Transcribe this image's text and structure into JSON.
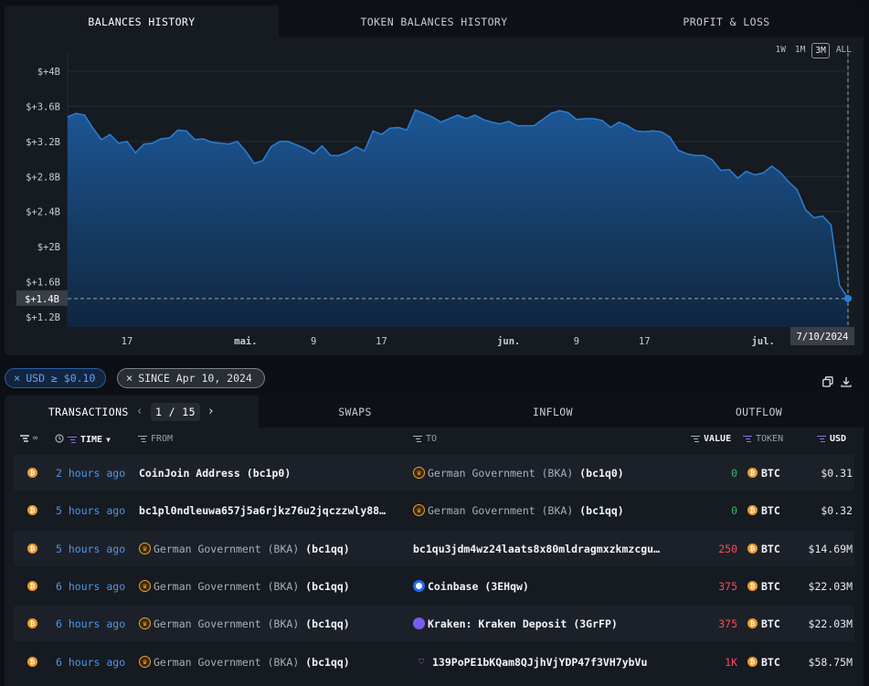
{
  "top_tabs": [
    "BALANCES HISTORY",
    "TOKEN BALANCES HISTORY",
    "PROFIT & LOSS"
  ],
  "time_ranges": [
    "1W",
    "1M",
    "3M",
    "ALL"
  ],
  "selected_range": "3M",
  "chart_data": {
    "type": "area",
    "y_ticks": [
      "$+4B",
      "$+3.6B",
      "$+3.2B",
      "$+2.8B",
      "$+2.4B",
      "$+2B",
      "$+1.6B",
      "$+1.2B"
    ],
    "x_ticks": [
      "17",
      "mai.",
      "9",
      "17",
      "jun.",
      "9",
      "17",
      "jul."
    ],
    "crosshair_y_label": "$+1.4B",
    "crosshair_x_label": "7/10/2024",
    "ylim": [
      1.2,
      4.0
    ],
    "y_unit": "billion USD",
    "x": [
      "2024-04-10",
      "2024-04-11",
      "2024-04-12",
      "2024-04-13",
      "2024-04-14",
      "2024-04-15",
      "2024-04-16",
      "2024-04-17",
      "2024-04-18",
      "2024-04-19",
      "2024-04-20",
      "2024-04-21",
      "2024-04-22",
      "2024-04-23",
      "2024-04-24",
      "2024-04-25",
      "2024-04-26",
      "2024-04-27",
      "2024-04-28",
      "2024-04-29",
      "2024-04-30",
      "2024-05-01",
      "2024-05-02",
      "2024-05-03",
      "2024-05-04",
      "2024-05-05",
      "2024-05-06",
      "2024-05-07",
      "2024-05-08",
      "2024-05-09",
      "2024-05-10",
      "2024-05-11",
      "2024-05-12",
      "2024-05-13",
      "2024-05-14",
      "2024-05-15",
      "2024-05-16",
      "2024-05-17",
      "2024-05-18",
      "2024-05-19",
      "2024-05-20",
      "2024-05-21",
      "2024-05-22",
      "2024-05-23",
      "2024-05-24",
      "2024-05-25",
      "2024-05-26",
      "2024-05-27",
      "2024-05-28",
      "2024-05-29",
      "2024-05-30",
      "2024-05-31",
      "2024-06-01",
      "2024-06-02",
      "2024-06-03",
      "2024-06-04",
      "2024-06-05",
      "2024-06-06",
      "2024-06-07",
      "2024-06-08",
      "2024-06-09",
      "2024-06-10",
      "2024-06-11",
      "2024-06-12",
      "2024-06-13",
      "2024-06-14",
      "2024-06-15",
      "2024-06-16",
      "2024-06-17",
      "2024-06-18",
      "2024-06-19",
      "2024-06-20",
      "2024-06-21",
      "2024-06-22",
      "2024-06-23",
      "2024-06-24",
      "2024-06-25",
      "2024-06-26",
      "2024-06-27",
      "2024-06-28",
      "2024-06-29",
      "2024-06-30",
      "2024-07-01",
      "2024-07-02",
      "2024-07-03",
      "2024-07-04",
      "2024-07-05",
      "2024-07-06",
      "2024-07-07",
      "2024-07-08",
      "2024-07-09",
      "2024-07-10"
    ],
    "values": [
      3.48,
      3.52,
      3.5,
      3.35,
      3.22,
      3.28,
      3.18,
      3.2,
      3.07,
      3.17,
      3.18,
      3.23,
      3.24,
      3.33,
      3.32,
      3.22,
      3.23,
      3.19,
      3.18,
      3.17,
      3.2,
      3.09,
      2.95,
      2.98,
      3.14,
      3.2,
      3.2,
      3.16,
      3.12,
      3.06,
      3.15,
      3.04,
      3.04,
      3.08,
      3.14,
      3.09,
      3.32,
      3.28,
      3.35,
      3.36,
      3.33,
      3.56,
      3.52,
      3.48,
      3.42,
      3.46,
      3.5,
      3.46,
      3.5,
      3.45,
      3.42,
      3.4,
      3.43,
      3.38,
      3.38,
      3.38,
      3.45,
      3.52,
      3.55,
      3.53,
      3.45,
      3.46,
      3.46,
      3.44,
      3.36,
      3.42,
      3.38,
      3.32,
      3.31,
      3.32,
      3.31,
      3.25,
      3.1,
      3.06,
      3.04,
      3.04,
      2.99,
      2.87,
      2.88,
      2.78,
      2.86,
      2.82,
      2.84,
      2.92,
      2.85,
      2.74,
      2.65,
      2.42,
      2.33,
      2.35,
      2.25,
      1.56,
      1.41
    ]
  },
  "filters": {
    "usd_chip": "USD ≥ $0.10",
    "since_chip": "SINCE Apr 10, 2024"
  },
  "bottom_tabs": {
    "transactions": "TRANSACTIONS",
    "pager": "1 / 15",
    "swaps": "SWAPS",
    "inflow": "INFLOW",
    "outflow": "OUTFLOW"
  },
  "columns": {
    "time": "TIME",
    "from": "FROM",
    "to": "TO",
    "value": "VALUE",
    "token": "TOKEN",
    "usd": "USD"
  },
  "rows": [
    {
      "time": "2 hours ago",
      "from_name": "CoinJoin Address",
      "from_tag": "(bc1p0)",
      "from_icon": "",
      "to_name": "German Government (BKA)",
      "to_tag": "(bc1q0)",
      "to_icon": "gov",
      "value": "0",
      "token": "BTC",
      "usd": "$0.31",
      "dir": "in"
    },
    {
      "time": "5 hours ago",
      "from_name": "bc1pl0ndleuwa657j5a6rjkz76u2jqczzwly88…",
      "from_tag": "",
      "from_icon": "",
      "to_name": "German Government (BKA)",
      "to_tag": "(bc1qq)",
      "to_icon": "gov",
      "value": "0",
      "token": "BTC",
      "usd": "$0.32",
      "dir": "in"
    },
    {
      "time": "5 hours ago",
      "from_name": "German Government (BKA)",
      "from_tag": "(bc1qq)",
      "from_icon": "gov",
      "to_name": "bc1qu3jdm4wz24laats8x80mldragmxzkmzcgu…",
      "to_tag": "",
      "to_icon": "",
      "value": "250",
      "token": "BTC",
      "usd": "$14.69M",
      "dir": "out"
    },
    {
      "time": "6 hours ago",
      "from_name": "German Government (BKA)",
      "from_tag": "(bc1qq)",
      "from_icon": "gov",
      "to_name": "Coinbase",
      "to_tag": "(3EHqw)",
      "to_icon": "coinbase",
      "value": "375",
      "token": "BTC",
      "usd": "$22.03M",
      "dir": "out"
    },
    {
      "time": "6 hours ago",
      "from_name": "German Government (BKA)",
      "from_tag": "(bc1qq)",
      "from_icon": "gov",
      "to_name": "Kraken: Kraken Deposit",
      "to_tag": "(3GrFP)",
      "to_icon": "kraken",
      "value": "375",
      "token": "BTC",
      "usd": "$22.03M",
      "dir": "out"
    },
    {
      "time": "6 hours ago",
      "from_name": "German Government (BKA)",
      "from_tag": "(bc1qq)",
      "from_icon": "gov",
      "to_name": "139PoPE1bKQam8QJjhVjYDP47f3VH7ybVu",
      "to_tag": "",
      "to_icon": "unknown",
      "value": "1K",
      "token": "BTC",
      "usd": "$58.75M",
      "dir": "out"
    }
  ],
  "colors": {
    "background": "#0c0f14",
    "panel": "#161a21",
    "chart_line": "#2a7fd4",
    "time_link": "#4e97e8",
    "value_in": "#37b86a",
    "value_out": "#ef4f5f",
    "btc": "#f09a26"
  }
}
